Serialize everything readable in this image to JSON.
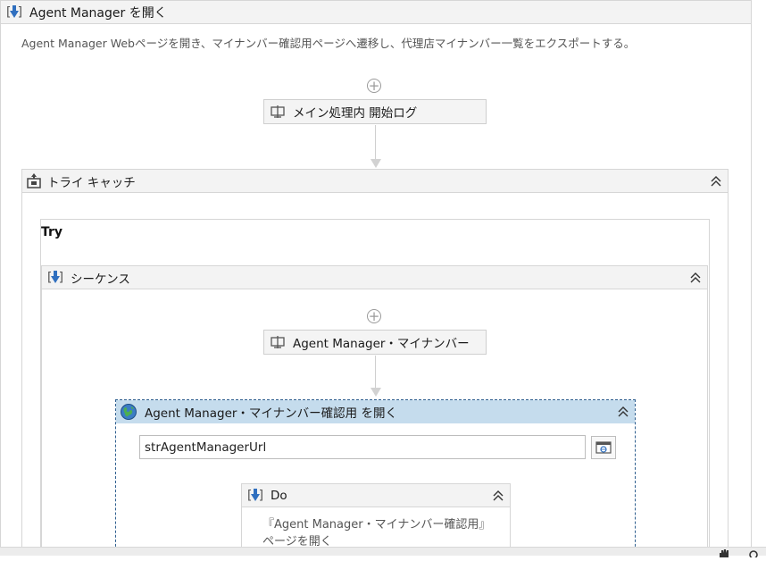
{
  "outer": {
    "title": "Agent Manager を開く",
    "description": "Agent Manager Webページを開き、マイナンバー確認用ページへ遷移し、代理店マイナンバー一覧をエクスポートする。"
  },
  "activity_log": {
    "label": "メイン処理内 開始ログ"
  },
  "try_catch": {
    "title": "トライ キャッチ",
    "try_label": "Try"
  },
  "sequence": {
    "title": "シーケンス"
  },
  "activity_agent": {
    "label": "Agent Manager・マイナンバー"
  },
  "browser": {
    "title": "Agent Manager・マイナンバー確認用 を開く",
    "url_value": "strAgentManagerUrl"
  },
  "do_block": {
    "title": "Do",
    "annotation": "『Agent Manager・マイナンバー確認用』ページを開く"
  },
  "colors": {
    "selected_header": "#c5dced",
    "accent": "#3b73b9"
  }
}
